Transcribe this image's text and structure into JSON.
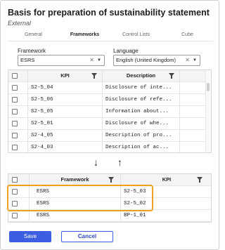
{
  "header": {
    "title": "Basis for preparation of sustainability statement",
    "subtitle": "External"
  },
  "tabs": [
    {
      "label": "General",
      "active": false
    },
    {
      "label": "Frameworks",
      "active": true
    },
    {
      "label": "Control Lists",
      "active": false
    },
    {
      "label": "Cube",
      "active": false
    }
  ],
  "filters": {
    "framework": {
      "label": "Framework",
      "value": "ESRS"
    },
    "language": {
      "label": "Language",
      "value": "English (United Kingdom)"
    }
  },
  "top_table": {
    "columns": [
      "KPI",
      "Description"
    ],
    "rows": [
      {
        "kpi": "S2-5_04",
        "description": "Disclosure of inte..."
      },
      {
        "kpi": "S2-5_06",
        "description": "Disclosure of refe..."
      },
      {
        "kpi": "S2-5_05",
        "description": "Information about..."
      },
      {
        "kpi": "S2-5_01",
        "description": "Disclosure of whe..."
      },
      {
        "kpi": "S2-4_05",
        "description": "Description of pro..."
      },
      {
        "kpi": "S2-4_03",
        "description": "Description of ac..."
      }
    ]
  },
  "bottom_table": {
    "columns": [
      "Framework",
      "KPI"
    ],
    "rows": [
      {
        "framework": "ESRS",
        "kpi": "S2-5_03"
      },
      {
        "framework": "ESRS",
        "kpi": "S2-5_02"
      },
      {
        "framework": "ESRS",
        "kpi": "BP-1_01"
      }
    ]
  },
  "arrows": {
    "down": "↓",
    "up": "↑"
  },
  "icons": {
    "clear": "close-icon",
    "caret": "chevron-down-icon",
    "filter": "filter-icon"
  },
  "buttons": {
    "save": "Save",
    "cancel": "Cancel"
  },
  "colors": {
    "accent": "#3b5fe0",
    "highlight": "#f0a020"
  }
}
